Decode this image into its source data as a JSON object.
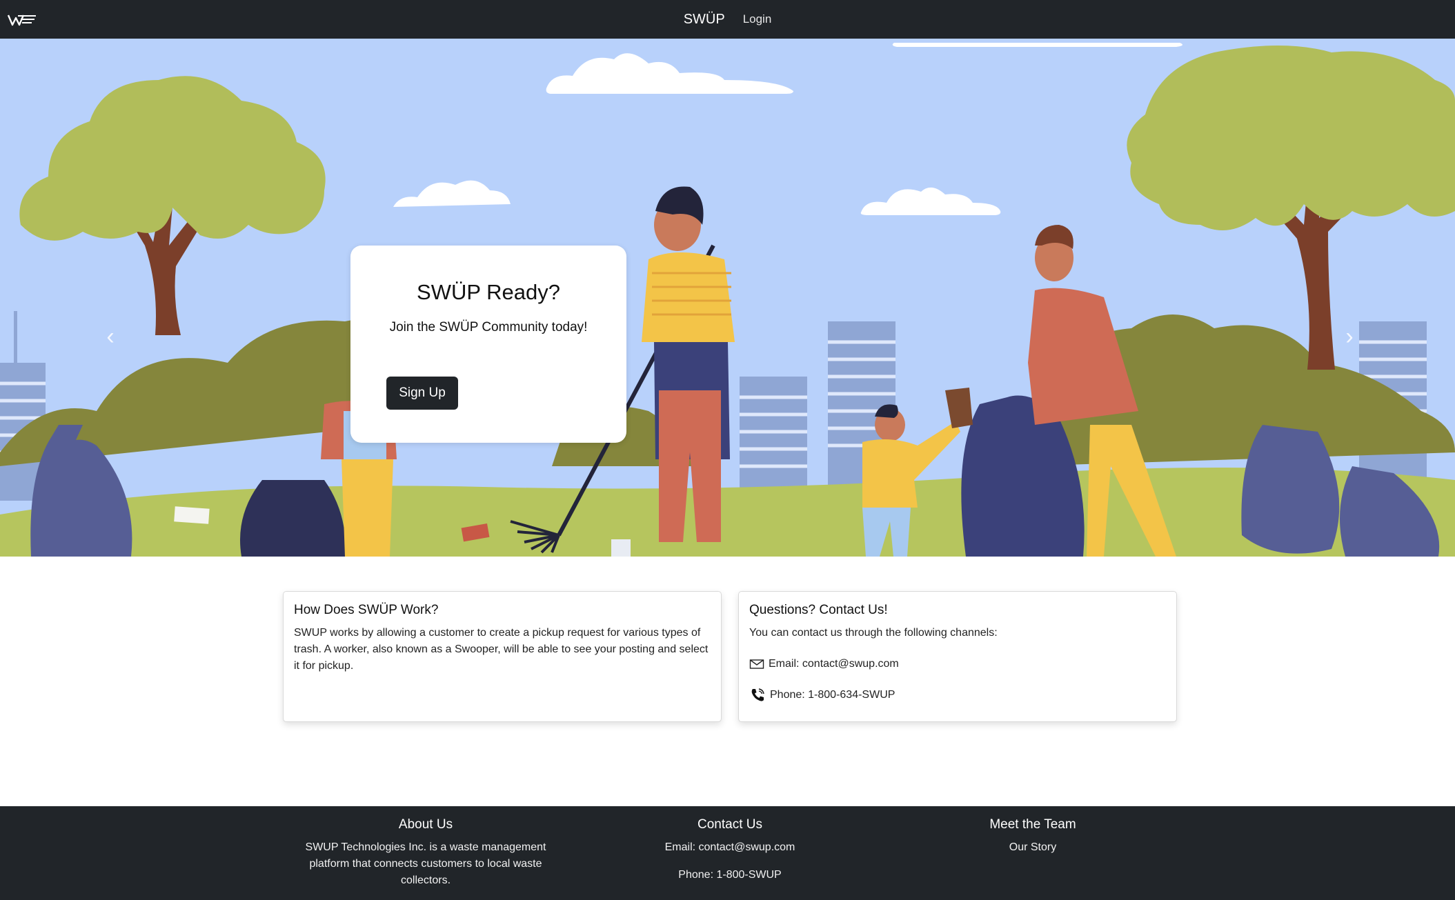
{
  "navbar": {
    "brand": "SWÜP",
    "login_label": "Login",
    "logo_icon": "swup-logo-icon"
  },
  "hero": {
    "card_title": "SWÜP Ready?",
    "card_subtitle": "Join the SWÜP Community today!",
    "signup_label": "Sign Up",
    "prev_icon": "chevron-left-icon",
    "next_icon": "chevron-right-icon",
    "slides": 3,
    "active_slide": 2,
    "sky_color": "#b8d1fb"
  },
  "how_card": {
    "title": "How Does SWÜP Work?",
    "body": "SWUP works by allowing a customer to create a pickup request for various types of trash. A worker, also known as a Swooper, will be able to see your posting and select it for pickup."
  },
  "contact_card": {
    "title": "Questions? Contact Us!",
    "intro": "You can contact us through the following channels:",
    "email": "Email: contact@swup.com",
    "phone": "Phone: 1-800-634-SWUP",
    "email_icon": "envelope-icon",
    "phone_icon": "phone-icon"
  },
  "footer": {
    "about_title": "About Us",
    "about_text": "SWUP Technologies Inc. is a waste management platform that connects customers to local waste collectors.",
    "contact_title": "Contact Us",
    "contact_email": "Email: contact@swup.com",
    "contact_phone": "Phone: 1-800-SWUP",
    "team_title": "Meet the Team",
    "team_link": "Our Story"
  },
  "colors": {
    "dark": "#212529",
    "tree_green": "#b1bd5a",
    "bush_green": "#85863c",
    "grass": "#b6c55e"
  }
}
